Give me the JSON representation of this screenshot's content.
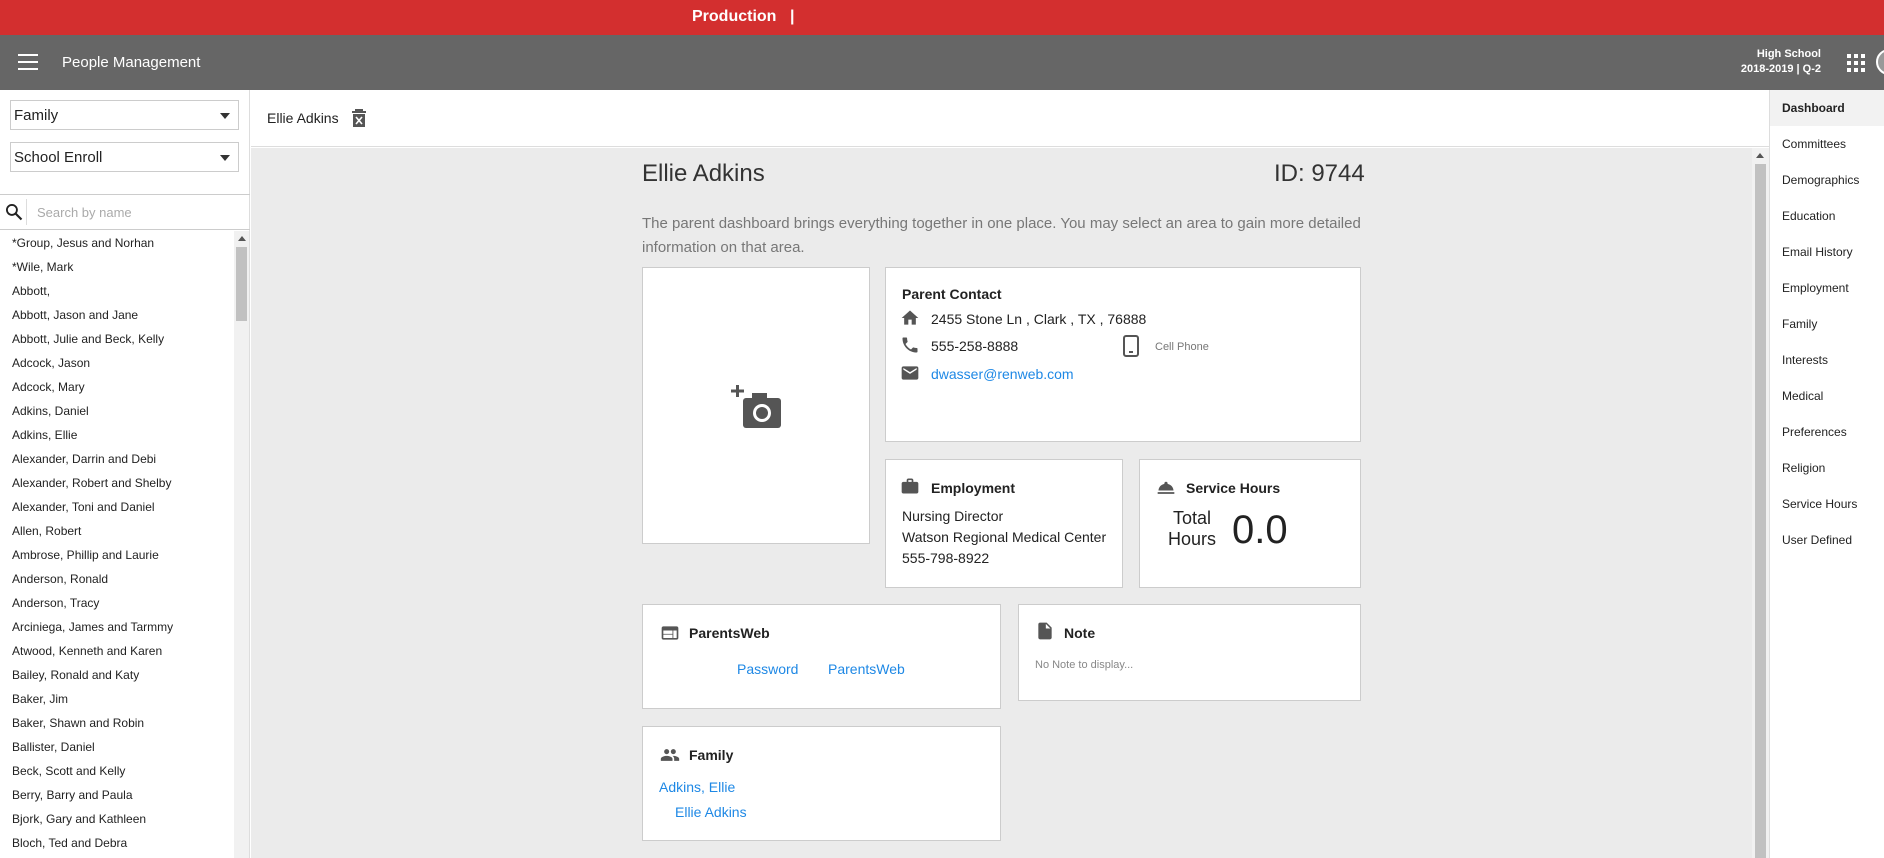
{
  "environment": {
    "label": "Production",
    "separator": "|"
  },
  "header": {
    "title": "People Management",
    "school": "High School",
    "term": "2018-2019 | Q-2"
  },
  "sidebar": {
    "filter_type": "Family",
    "filter_status": "School Enroll",
    "search_placeholder": "Search by name",
    "people": [
      "*Group, Jesus and Norhan",
      "*Wile, Mark",
      "Abbott,",
      "Abbott, Jason and Jane",
      "Abbott, Julie and Beck, Kelly",
      "Adcock, Jason",
      "Adcock, Mary",
      "Adkins, Daniel",
      "Adkins, Ellie",
      "Alexander, Darrin and Debi",
      "Alexander, Robert and Shelby",
      "Alexander, Toni and Daniel",
      "Allen, Robert",
      "Ambrose, Phillip and Laurie",
      "Anderson, Ronald",
      "Anderson, Tracy",
      "Arciniega, James and Tarmmy",
      "Atwood, Kenneth and Karen",
      "Bailey, Ronald and Katy",
      "Baker, Jim",
      "Baker, Shawn and Robin",
      "Ballister, Daniel",
      "Beck, Scott and Kelly",
      "Berry, Barry and Paula",
      "Bjork, Gary and Kathleen",
      "Bloch, Ted and Debra"
    ]
  },
  "content_header": {
    "name": "Ellie Adkins"
  },
  "dashboard": {
    "name": "Ellie Adkins",
    "id_label": "ID: 9744",
    "intro": "The parent dashboard brings everything together in one place. You may select an area to gain more detailed information on that area.",
    "contact": {
      "title": "Parent Contact",
      "address": "2455 Stone Ln , Clark , TX , 76888",
      "phone": "555-258-8888",
      "phone_type": "Cell Phone",
      "email": "dwasser@renweb.com"
    },
    "employment": {
      "title": "Employment",
      "position": "Nursing Director",
      "employer": "Watson Regional Medical Center",
      "phone": "555-798-8922"
    },
    "service_hours": {
      "title": "Service Hours",
      "label": "Total Hours",
      "value": "0.0"
    },
    "parentsweb": {
      "title": "ParentsWeb",
      "password_link": "Password",
      "parentsweb_link": "ParentsWeb"
    },
    "note": {
      "title": "Note",
      "text": "No Note to display..."
    },
    "family": {
      "title": "Family",
      "family_link": "Adkins, Ellie",
      "member_link": "Ellie Adkins"
    }
  },
  "right_nav": {
    "active": "Dashboard",
    "items": [
      "Dashboard",
      "Committees",
      "Demographics",
      "Education",
      "Email History",
      "Employment",
      "Family",
      "Interests",
      "Medical",
      "Preferences",
      "Religion",
      "Service Hours",
      "User Defined"
    ]
  },
  "colors": {
    "env_bar": "#d32f2f",
    "header": "#666666",
    "link": "#1e88e5",
    "content_bg": "#ebebeb"
  },
  "icons": [
    "menu-icon",
    "apps-grid-icon",
    "search-icon",
    "trash-icon",
    "add-photo-icon",
    "home-icon",
    "phone-icon",
    "mobile-icon",
    "email-icon",
    "briefcase-icon",
    "service-bell-icon",
    "web-icon",
    "note-icon",
    "people-icon"
  ]
}
